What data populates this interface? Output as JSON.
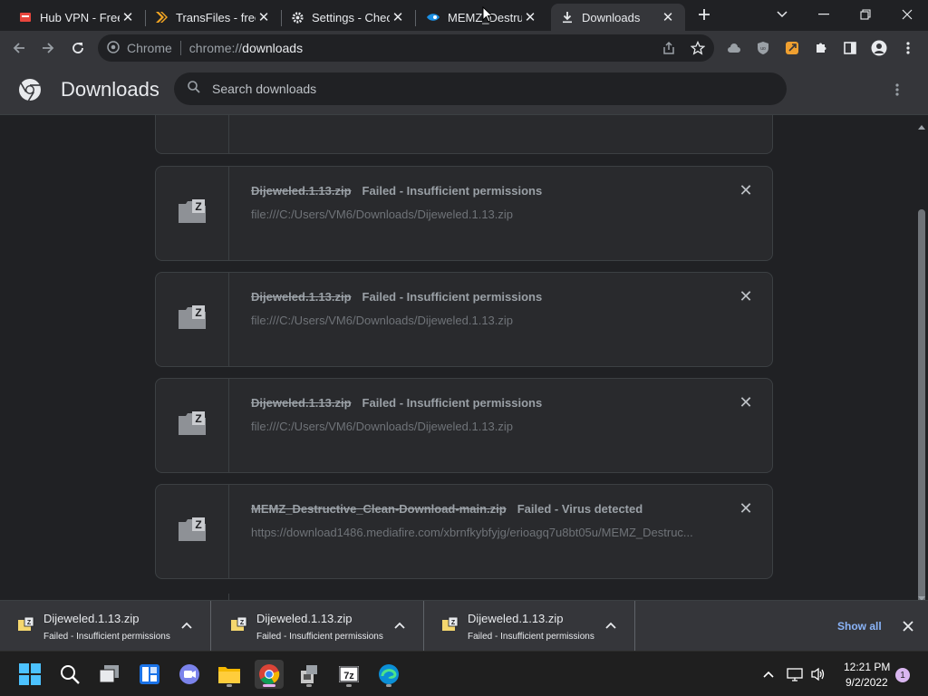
{
  "tabs": [
    {
      "title": "Hub VPN - Free",
      "icon": "hub-vpn-favicon"
    },
    {
      "title": "TransFiles - free",
      "icon": "transfiles-favicon"
    },
    {
      "title": "Settings - Check",
      "icon": "gear-favicon"
    },
    {
      "title": "MEMZ_Destruct",
      "icon": "mediafire-favicon"
    },
    {
      "title": "Downloads",
      "icon": "download-favicon"
    }
  ],
  "omnibox": {
    "site_label": "Chrome",
    "url_scheme": "chrome://",
    "url_host": "downloads"
  },
  "downloads_page": {
    "title": "Downloads",
    "search_placeholder": "Search downloads"
  },
  "items": [
    {
      "filename": "Dijeweled.1.13.zip",
      "status": "Failed - Insufficient permissions",
      "path": "file:///C:/Users/VM6/Downloads/Dijeweled.1.13.zip"
    },
    {
      "filename": "Dijeweled.1.13.zip",
      "status": "Failed - Insufficient permissions",
      "path": "file:///C:/Users/VM6/Downloads/Dijeweled.1.13.zip"
    },
    {
      "filename": "Dijeweled.1.13.zip",
      "status": "Failed - Insufficient permissions",
      "path": "file:///C:/Users/VM6/Downloads/Dijeweled.1.13.zip"
    },
    {
      "filename": "MEMZ_Destructive_Clean-Download-main.zip",
      "status": "Failed - Virus detected",
      "path": "https://download1486.mediafire.com/xbrnfkybfyjg/erioagq7u8bt05u/MEMZ_Destruc..."
    }
  ],
  "shelf": {
    "items": [
      {
        "filename": "Dijeweled.1.13.zip",
        "status": "Failed - Insufficient permissions"
      },
      {
        "filename": "Dijeweled.1.13.zip",
        "status": "Failed - Insufficient permissions"
      },
      {
        "filename": "Dijeweled.1.13.zip",
        "status": "Failed - Insufficient permissions"
      }
    ],
    "show_all_label": "Show all"
  },
  "taskbar": {
    "time": "12:21 PM",
    "date": "9/2/2022",
    "notification_count": "1"
  },
  "colors": {
    "accent_link": "#8ab4f8",
    "background": "#202124",
    "toolbar": "#35363a"
  }
}
